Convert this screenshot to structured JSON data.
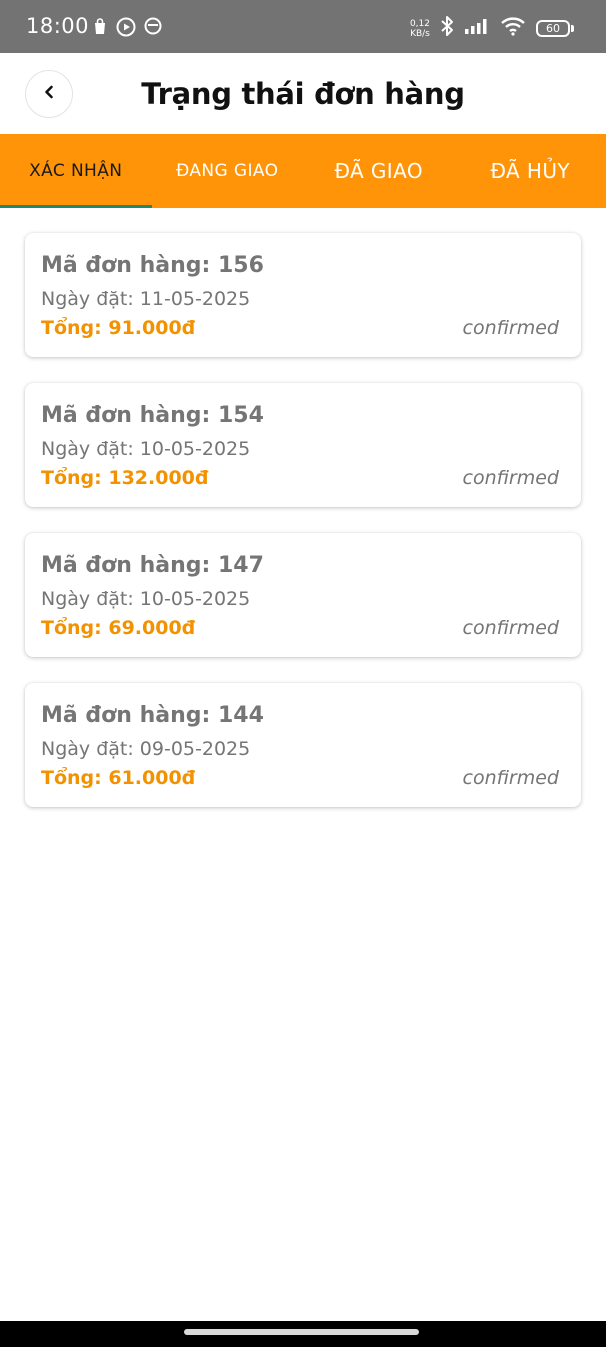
{
  "status_bar": {
    "time": "18:00",
    "net_speed_value": "0,12",
    "net_speed_unit": "KB/s",
    "battery": "60"
  },
  "header": {
    "title": "Trạng thái đơn hàng"
  },
  "tabs": [
    {
      "label": "XÁC NHẬN",
      "active": true
    },
    {
      "label": "ĐANG GIAO",
      "active": false
    },
    {
      "label": "ĐÃ GIAO",
      "active": false
    },
    {
      "label": "ĐÃ HỦY",
      "active": false
    }
  ],
  "orders": [
    {
      "id_text": "Mã đơn hàng: 156",
      "date_text": "Ngày đặt: 11-05-2025",
      "total_text": "Tổng: 91.000đ",
      "status": "confirmed"
    },
    {
      "id_text": "Mã đơn hàng: 154",
      "date_text": "Ngày đặt: 10-05-2025",
      "total_text": "Tổng: 132.000đ",
      "status": "confirmed"
    },
    {
      "id_text": "Mã đơn hàng: 147",
      "date_text": "Ngày đặt: 10-05-2025",
      "total_text": "Tổng: 69.000đ",
      "status": "confirmed"
    },
    {
      "id_text": "Mã đơn hàng: 144",
      "date_text": "Ngày đặt: 09-05-2025",
      "total_text": "Tổng: 61.000đ",
      "status": "confirmed"
    }
  ],
  "colors": {
    "accent_orange": "#ff9408",
    "total_orange": "#f39200",
    "active_underline": "#1e8a6a",
    "muted_text": "#757575"
  }
}
